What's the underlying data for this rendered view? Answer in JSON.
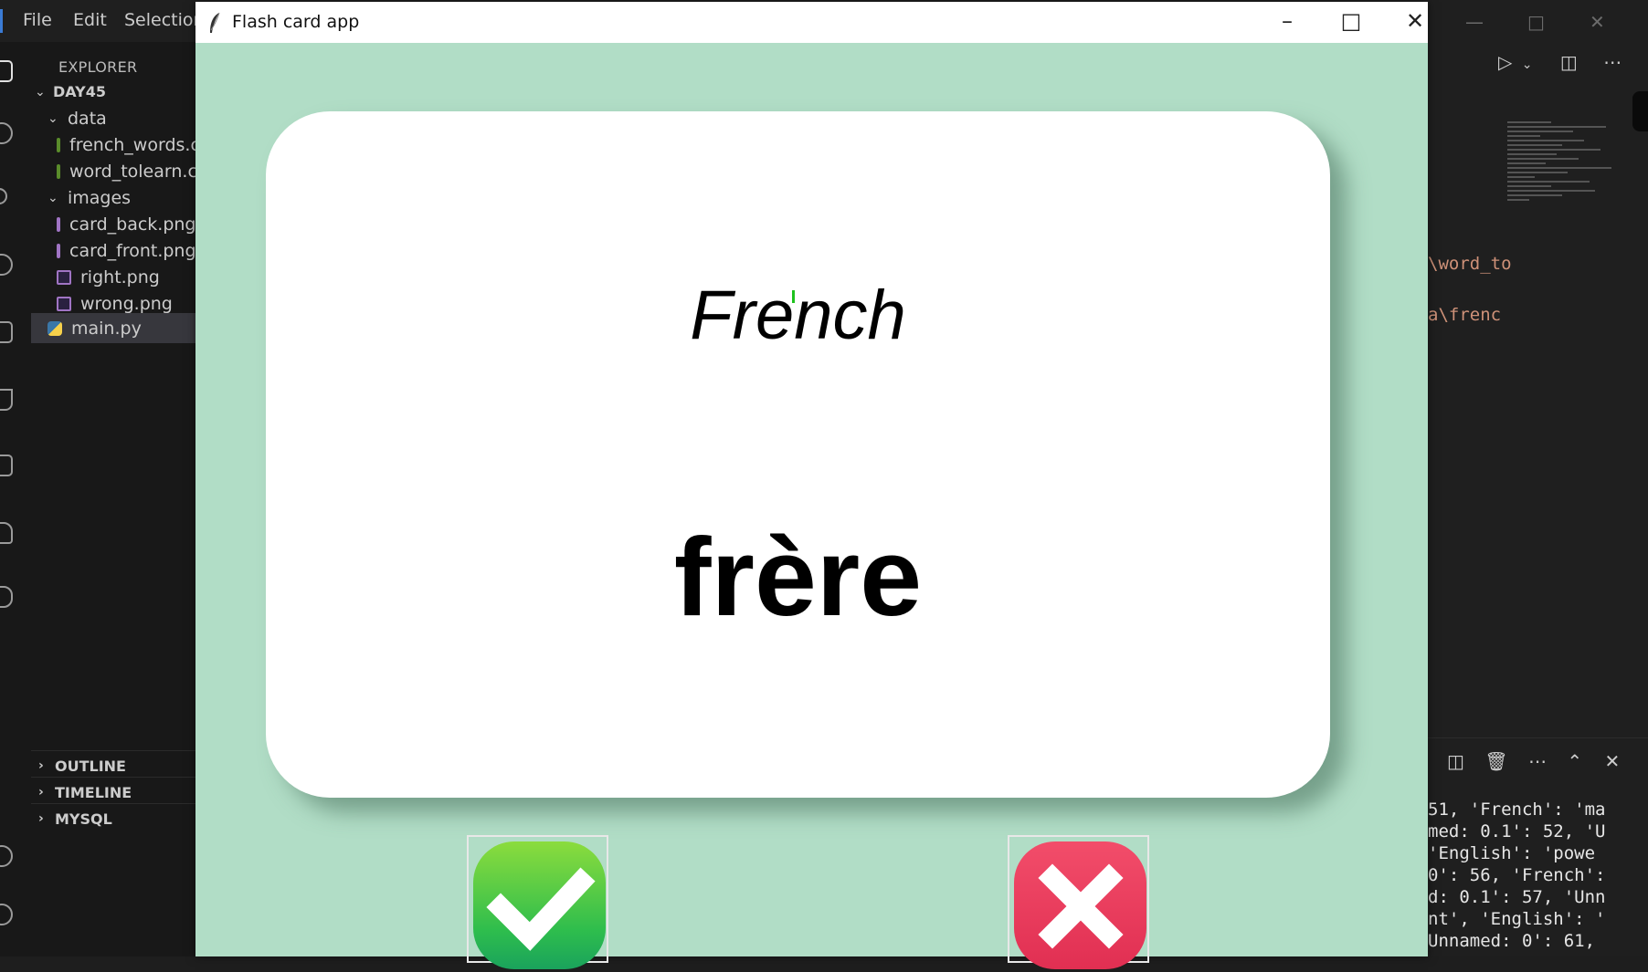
{
  "vscode": {
    "menu": [
      "File",
      "Edit",
      "Selection"
    ],
    "explorer_header": "EXPLORER",
    "workspace": "DAY45",
    "tree": [
      {
        "type": "folder",
        "label": "data"
      },
      {
        "type": "csv",
        "label": "french_words.csv"
      },
      {
        "type": "csv",
        "label": "word_tolearn.csv"
      },
      {
        "type": "folder",
        "label": "images"
      },
      {
        "type": "png",
        "label": "card_back.png"
      },
      {
        "type": "png",
        "label": "card_front.png"
      },
      {
        "type": "png",
        "label": "right.png"
      },
      {
        "type": "png",
        "label": "wrong.png"
      },
      {
        "type": "py",
        "label": "main.py"
      }
    ],
    "sections": [
      "OUTLINE",
      "TIMELINE",
      "MYSQL"
    ],
    "code_snippets": [
      "\\word_to",
      "a\\frenc"
    ],
    "terminal_lines": [
      "51, 'French': 'ma",
      "med: 0.1': 52, 'U",
      " 'English': 'powe",
      "0': 56, 'French':",
      "d: 0.1': 57, 'Unn",
      "nt', 'English': '",
      "Unnamed: 0': 61,"
    ]
  },
  "app": {
    "title": "Flash card app",
    "card": {
      "language": "French",
      "word": "frère"
    },
    "buttons": {
      "right": "right-icon",
      "wrong": "wrong-icon"
    },
    "colors": {
      "background": "#b1ddc6",
      "card": "#ffffff"
    }
  }
}
